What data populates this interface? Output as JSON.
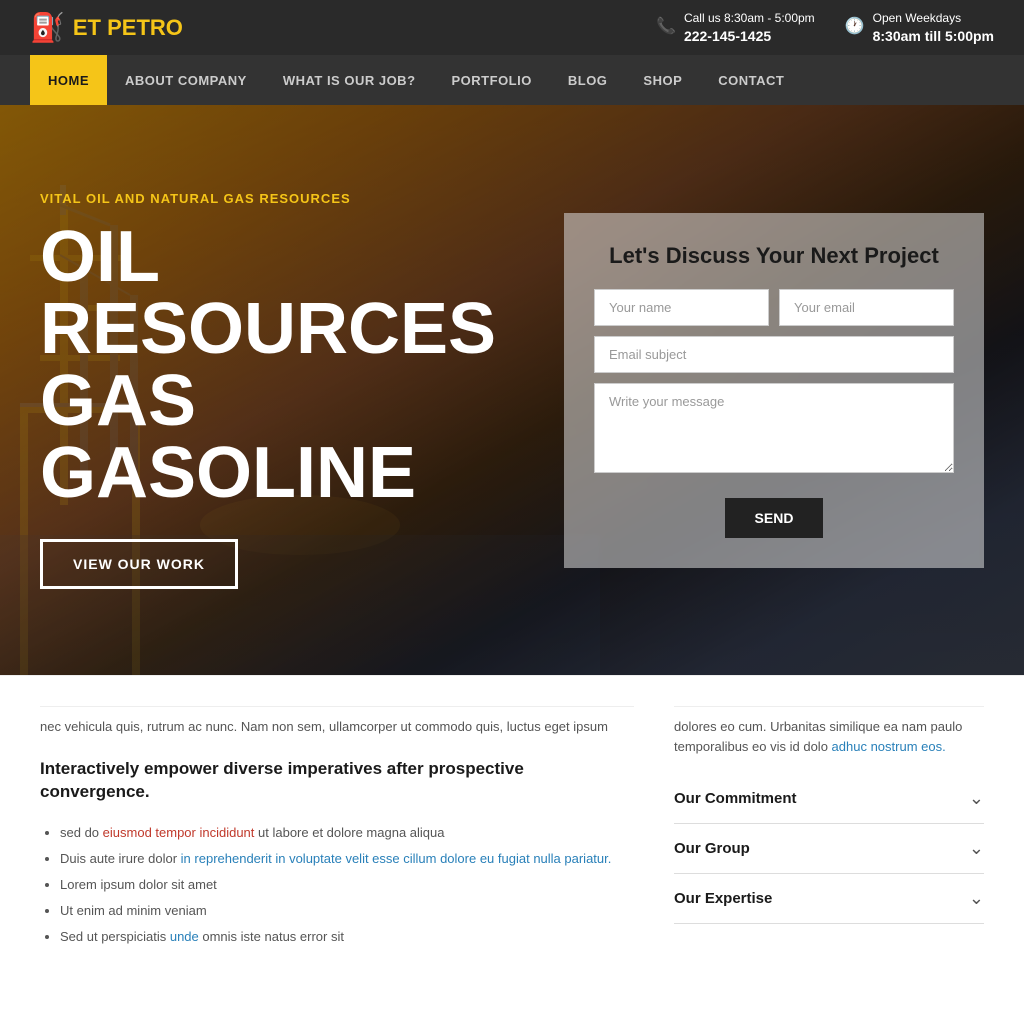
{
  "topbar": {
    "logo_prefix": "ET ",
    "logo_suffix": "PETRO",
    "phone_icon": "📞",
    "phone_label": "Call us 8:30am - 5:00pm",
    "phone_number": "222-145-1425",
    "clock_icon": "🕐",
    "hours_label": "Open Weekdays",
    "hours_value": "8:30am till 5:00pm"
  },
  "nav": {
    "items": [
      {
        "label": "HOME",
        "active": true
      },
      {
        "label": "ABOUT COMPANY",
        "active": false
      },
      {
        "label": "WHAT IS OUR JOB?",
        "active": false
      },
      {
        "label": "PORTFOLIO",
        "active": false
      },
      {
        "label": "BLOG",
        "active": false
      },
      {
        "label": "SHOP",
        "active": false
      },
      {
        "label": "CONTACT",
        "active": false
      }
    ]
  },
  "hero": {
    "subtitle": "VITAL OIL AND NATURAL GAS RESOURCES",
    "title_line1": "OIL",
    "title_line2": "RESOURCES",
    "title_line3": "GAS",
    "title_line4": "GASOLINE",
    "cta_label": "VIEW OUR WORK"
  },
  "contact_form": {
    "title": "Let's Discuss Your Next Project",
    "name_placeholder": "Your name",
    "email_placeholder": "Your email",
    "subject_placeholder": "Email subject",
    "message_placeholder": "Write your message",
    "send_label": "Send"
  },
  "lower": {
    "truncated_left": "nec vehicula quis, rutrum ac nunc. Nam non sem, ullamcorper ut commodo quis, luctus eget ipsum",
    "main_heading": "Interactively empower diverse imperatives after prospective convergence.",
    "list_items": [
      {
        "text": "sed do eiusmod tempor incididunt ut labore et dolore magna aliqua",
        "highlight": "eiusmod tempor incididunt"
      },
      {
        "text": "Duis aute irure dolor in reprehenderit in voluptate velit esse cillum dolore eu fugiat nulla pariatur.",
        "highlight_blue": "in reprehenderit in voluptate velit esse cillum dolore eu fugiat nulla pariatur."
      },
      {
        "text": "Lorem ipsum dolor sit amet"
      },
      {
        "text": "Ut enim ad minim veniam"
      },
      {
        "text": "Sed ut perspiciatis unde omnis iste natus error sit",
        "highlight_blue": "unde"
      }
    ],
    "truncated_right": "dolores eo cum. Urbanitas similique ea nam paulo temporalibus eo vis id dolo adhuc nostrum eos.",
    "truncated_right_link": "adhuc nostrum eos.",
    "accordion": [
      {
        "label": "Our Commitment"
      },
      {
        "label": "Our Group"
      },
      {
        "label": "Our Expertise"
      }
    ]
  }
}
